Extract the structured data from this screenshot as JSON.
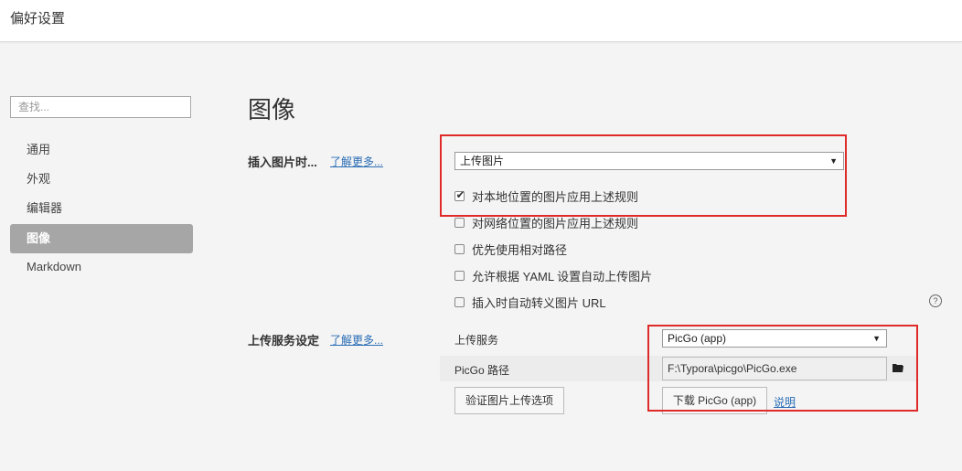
{
  "window": {
    "title": "偏好设置"
  },
  "sidebar": {
    "search_placeholder": "查找...",
    "items": [
      {
        "label": "通用",
        "active": false
      },
      {
        "label": "外观",
        "active": false
      },
      {
        "label": "编辑器",
        "active": false
      },
      {
        "label": "图像",
        "active": true
      },
      {
        "label": "Markdown",
        "active": false
      }
    ]
  },
  "main": {
    "heading": "图像",
    "insert_section": {
      "label": "插入图片时...",
      "learn_more": "了解更多...",
      "action_select": "上传图片",
      "options": [
        {
          "label": "对本地位置的图片应用上述规则",
          "checked": true
        },
        {
          "label": "对网络位置的图片应用上述规则",
          "checked": false
        },
        {
          "label": "优先使用相对路径",
          "checked": false
        },
        {
          "label": "允许根据 YAML 设置自动上传图片",
          "checked": false
        },
        {
          "label": "插入时自动转义图片 URL",
          "checked": false
        }
      ]
    },
    "upload_section": {
      "label": "上传服务设定",
      "learn_more": "了解更多...",
      "service_label": "上传服务",
      "service_select": "PicGo (app)",
      "path_label": "PicGo 路径",
      "path_value": "F:\\Typora\\picgo\\PicGo.exe",
      "verify_button": "验证图片上传选项",
      "download_button": "下载 PicGo (app)",
      "explain_link": "说明"
    }
  },
  "colors": {
    "highlight_box": "#e02a2a",
    "link": "#2a6db5",
    "active_nav": "#a6a6a6"
  },
  "icons": {
    "dropdown": "triangle-down-icon",
    "folder": "folder-icon",
    "help": "question-circle-icon",
    "check": "checkmark-icon"
  }
}
